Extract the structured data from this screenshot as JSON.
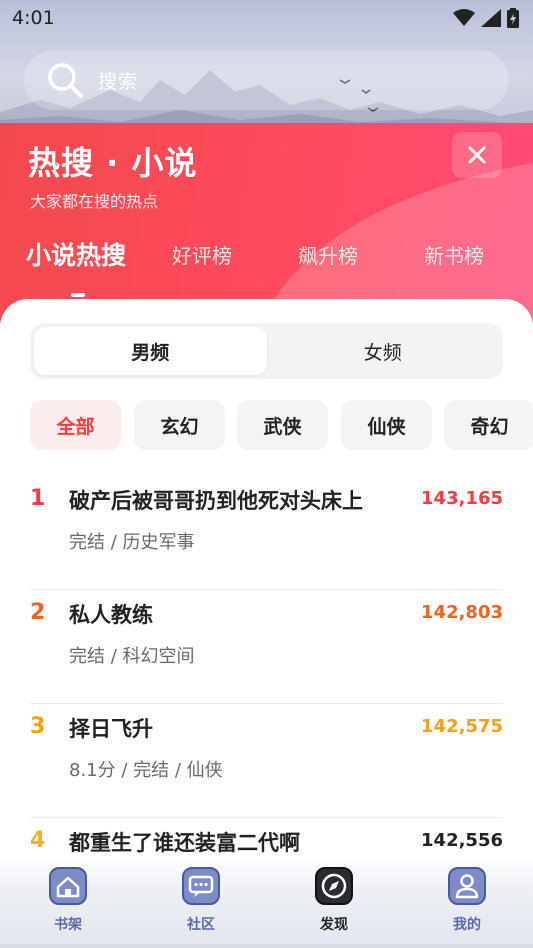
{
  "status_bar": {
    "time": "4:01"
  },
  "search": {
    "placeholder": "搜索"
  },
  "header": {
    "title": "热搜 · 小说",
    "subtitle": "大家都在搜的热点",
    "tabs": [
      {
        "label": "小说热搜",
        "active": true
      },
      {
        "label": "好评榜",
        "active": false
      },
      {
        "label": "飙升榜",
        "active": false
      },
      {
        "label": "新书榜",
        "active": false
      }
    ]
  },
  "gender": {
    "options": [
      "男频",
      "女频"
    ],
    "selected": "男频"
  },
  "categories": {
    "items": [
      "全部",
      "玄幻",
      "武侠",
      "仙侠",
      "奇幻"
    ],
    "selected": "全部"
  },
  "rankings": [
    {
      "rank": "1",
      "title": "破产后被哥哥扔到他死对头床上",
      "meta": "完结 / 历史军事",
      "score": "143,165",
      "color": "#f23b43"
    },
    {
      "rank": "2",
      "title": "私人教练",
      "meta": "完结 / 科幻空间",
      "score": "142,803",
      "color": "#f0621f"
    },
    {
      "rank": "3",
      "title": "择日飞升",
      "meta": "8.1分 / 完结 / 仙侠",
      "score": "142,575",
      "color": "#f7a00e"
    },
    {
      "rank": "4",
      "title": "都重生了谁还装富二代啊",
      "meta": "",
      "score": "142,556",
      "color": "#f2b12a"
    }
  ],
  "bottom_nav": [
    {
      "label": "书架",
      "icon": "house-icon",
      "active": false
    },
    {
      "label": "社区",
      "icon": "chat-icon",
      "active": false
    },
    {
      "label": "发现",
      "icon": "compass-icon",
      "active": true
    },
    {
      "label": "我的",
      "icon": "person-icon",
      "active": false
    }
  ],
  "colors": {
    "accent": "#f23b43",
    "header_red": "#ff4b5e",
    "nav_blue": "#5a6aa6"
  }
}
